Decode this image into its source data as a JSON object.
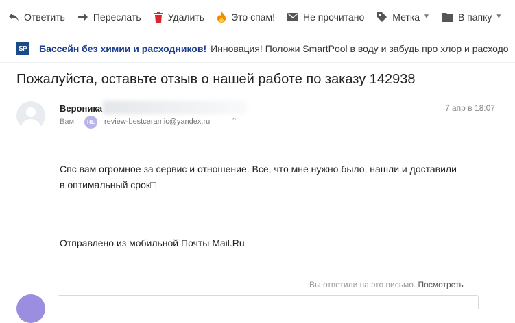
{
  "toolbar": {
    "reply_label": "Ответить",
    "forward_label": "Переслать",
    "delete_label": "Удалить",
    "spam_label": "Это спам!",
    "unread_label": "Не прочитано",
    "tag_label": "Метка",
    "folder_label": "В папку"
  },
  "ad": {
    "logo": "SP",
    "title": "Бассейн без химии и расходников!",
    "text": "Инновация! Положи SmartPool в воду и забудь про хлор и расходо"
  },
  "message": {
    "subject": "Пожалуйста, оставьте отзыв о нашей работе по заказу 142938",
    "sender_name": "Вероника",
    "date": "7 апр в 18:07",
    "to_label": "Вам:",
    "to_initials": "RE",
    "to_email": "review-bestceramic@yandex.ru",
    "body_line1": "Спс вам огромное за сервис и отношение. Все, что мне нужно было, нашли и доставили",
    "body_line2": "в оптимальный срок□",
    "signature": "Отправлено из мобильной Почты Mail.Ru"
  },
  "footer": {
    "replied_text": "Вы ответили на это письмо.",
    "view_link": "Посмотреть"
  },
  "colors": {
    "ad_title": "#1a3d8f",
    "delete_icon": "#d9272e",
    "spam_icon": "#f08c00",
    "chip": "#b9b4e8"
  },
  "icons": [
    "reply-icon",
    "forward-icon",
    "trash-icon",
    "fire-icon",
    "envelope-icon",
    "tag-icon",
    "folder-icon"
  ]
}
